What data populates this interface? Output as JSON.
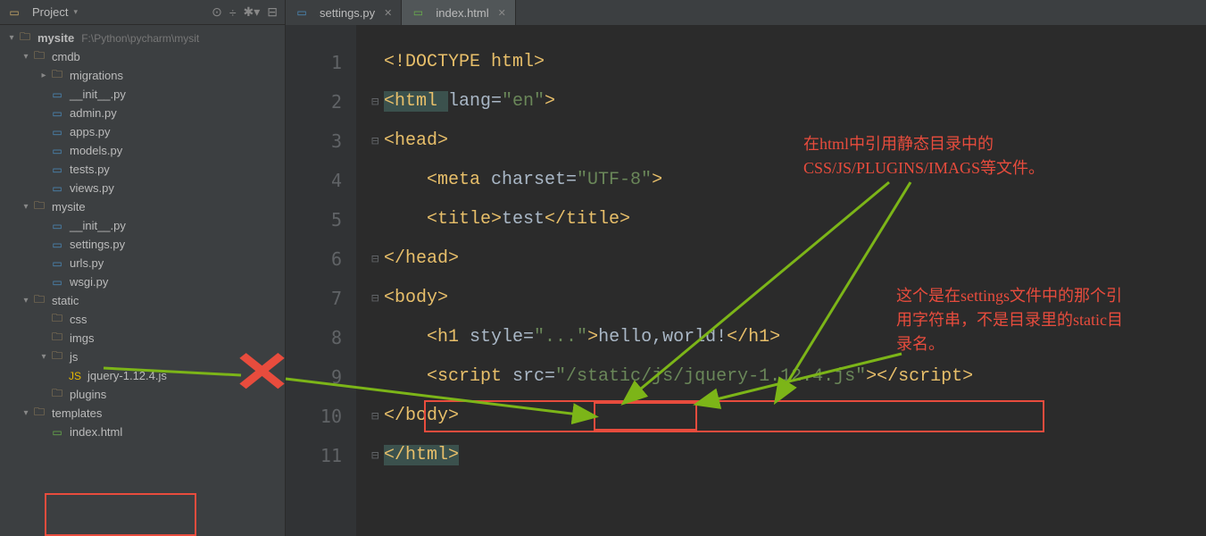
{
  "sidebar": {
    "title": "Project",
    "icons": [
      "⟳",
      "⇅",
      "✱",
      "⊟"
    ],
    "root": {
      "label": "mysite",
      "path": "F:\\Python\\pycharm\\mysit"
    },
    "items": [
      {
        "indent": 1,
        "arrow": "▾",
        "icon": "folder",
        "label": "cmdb"
      },
      {
        "indent": 2,
        "arrow": "▸",
        "icon": "folder",
        "label": "migrations"
      },
      {
        "indent": 2,
        "arrow": "",
        "icon": "py",
        "label": "__init__.py"
      },
      {
        "indent": 2,
        "arrow": "",
        "icon": "py",
        "label": "admin.py"
      },
      {
        "indent": 2,
        "arrow": "",
        "icon": "py",
        "label": "apps.py"
      },
      {
        "indent": 2,
        "arrow": "",
        "icon": "py",
        "label": "models.py"
      },
      {
        "indent": 2,
        "arrow": "",
        "icon": "py",
        "label": "tests.py"
      },
      {
        "indent": 2,
        "arrow": "",
        "icon": "py",
        "label": "views.py"
      },
      {
        "indent": 1,
        "arrow": "▾",
        "icon": "folder",
        "label": "mysite"
      },
      {
        "indent": 2,
        "arrow": "",
        "icon": "py",
        "label": "__init__.py"
      },
      {
        "indent": 2,
        "arrow": "",
        "icon": "py",
        "label": "settings.py"
      },
      {
        "indent": 2,
        "arrow": "",
        "icon": "py",
        "label": "urls.py"
      },
      {
        "indent": 2,
        "arrow": "",
        "icon": "py",
        "label": "wsgi.py"
      },
      {
        "indent": 1,
        "arrow": "▾",
        "icon": "folder",
        "label": "static"
      },
      {
        "indent": 2,
        "arrow": "",
        "icon": "folder",
        "label": "css"
      },
      {
        "indent": 2,
        "arrow": "",
        "icon": "folder",
        "label": "imgs"
      },
      {
        "indent": 2,
        "arrow": "▾",
        "icon": "folder",
        "label": "js"
      },
      {
        "indent": 3,
        "arrow": "",
        "icon": "js",
        "label": "jquery-1.12.4.js"
      },
      {
        "indent": 2,
        "arrow": "",
        "icon": "folder",
        "label": "plugins"
      },
      {
        "indent": 1,
        "arrow": "▾",
        "icon": "folder",
        "label": "templates"
      },
      {
        "indent": 2,
        "arrow": "",
        "icon": "html",
        "label": "index.html"
      }
    ]
  },
  "tabs": [
    {
      "icon": "py",
      "label": "settings.py",
      "active": false
    },
    {
      "icon": "html",
      "label": "index.html",
      "active": true
    }
  ],
  "gutter": [
    "1",
    "2",
    "3",
    "4",
    "5",
    "6",
    "7",
    "8",
    "9",
    "10",
    "11"
  ],
  "code": {
    "line1": {
      "text": "<!DOCTYPE html>"
    },
    "line2": {
      "tag": "<html ",
      "attr": "lang=",
      "str": "\"en\"",
      "close": ">"
    },
    "line3": {
      "text": "<head>"
    },
    "line4": {
      "tag": "<meta ",
      "attr": "charset=",
      "str": "\"UTF-8\"",
      "close": ">"
    },
    "line5": {
      "open": "<title>",
      "content": "test",
      "close": "</title>"
    },
    "line6": {
      "text": "</head>"
    },
    "line7": {
      "text": "<body>"
    },
    "line8": {
      "tag": "<h1 ",
      "attr": "style=",
      "str": "\"...\"",
      "close": ">",
      "content": "hello,world!",
      "end": "</h1>"
    },
    "line9": {
      "tag": "<script ",
      "attr": "src=",
      "str": "\"/static/js/jquery-1.12.4.js\"",
      "close": ">",
      "end1": "</",
      "end2": "script>"
    },
    "line10": {
      "text": "</body>"
    },
    "line11": {
      "text": "</html>"
    }
  },
  "annotations": {
    "note1_l1": "在html中引用静态目录中的",
    "note1_l2": "CSS/JS/PLUGINS/IMAGS等文件。",
    "note2_l1": "这个是在settings文件中的那个引",
    "note2_l2": "用字符串，不是目录里的static目",
    "note2_l3": "录名。"
  }
}
